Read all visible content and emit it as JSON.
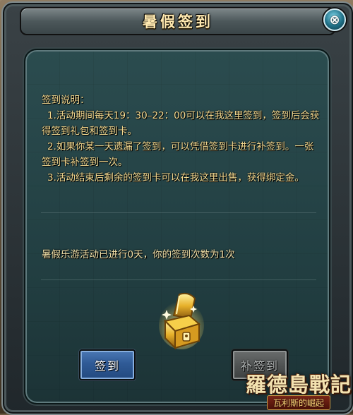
{
  "window": {
    "title": "暑假签到",
    "close_symbol": "⊗"
  },
  "instructions": {
    "heading": "签到说明：",
    "items": [
      "1.活动期间每天19：30–22：00可以在我这里签到，签到后会获得签到礼包和签到卡。",
      "2.如果你某一天遗漏了签到，可以凭借签到卡进行补签到。一张签到卡补签到一次。",
      "3.活动结束后剩余的签到卡可以在我这里出售，获得绑定金。"
    ]
  },
  "status": {
    "text": "暑假乐游活动已进行0天，你的签到次数为1次",
    "days_elapsed": 0,
    "checkin_count": 1
  },
  "buttons": {
    "sign_in": "签到",
    "make_up_sign_in": "补签到"
  },
  "reward": {
    "icon": "treasure-chest-icon"
  },
  "logo": {
    "main": "羅德島戰記",
    "sub": "瓦利斯的崛起"
  },
  "colors": {
    "text_gold": "#f4d98f",
    "title_gold": "#ffe9b0",
    "button_blue": "#2f5a96",
    "button_disabled": "#4f5252",
    "panel_teal": "#2b4c4f"
  }
}
